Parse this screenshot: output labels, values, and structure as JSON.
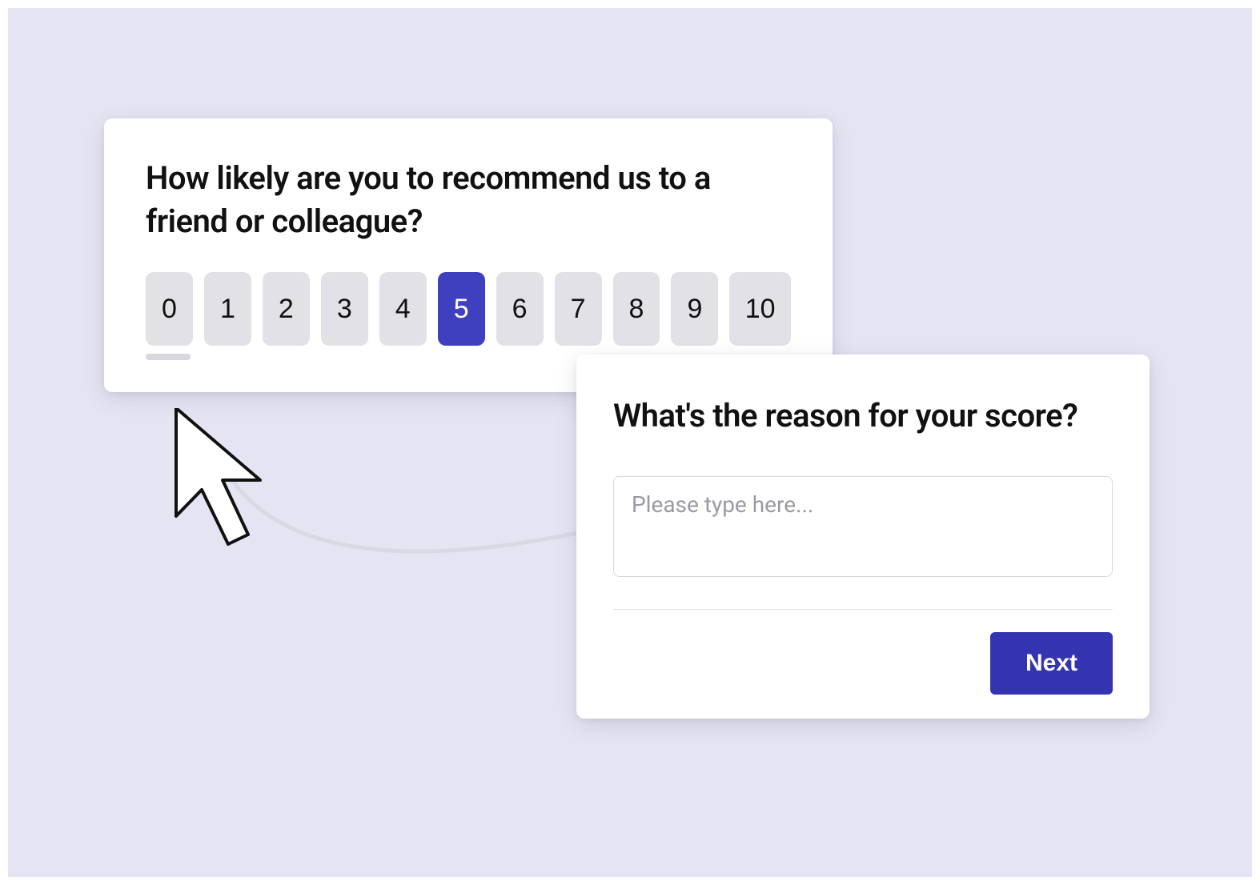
{
  "colors": {
    "background": "#e4e4f2",
    "accent": "#3f40bf",
    "button_primary": "#3534b0"
  },
  "nps": {
    "question": "How likely are you to recommend us to a friend or colleague?",
    "options": [
      "0",
      "1",
      "2",
      "3",
      "4",
      "5",
      "6",
      "7",
      "8",
      "9",
      "10"
    ],
    "selected": "5"
  },
  "reason": {
    "question": "What's the reason for your score?",
    "placeholder": "Please type here...",
    "value": "",
    "next_label": "Next"
  }
}
